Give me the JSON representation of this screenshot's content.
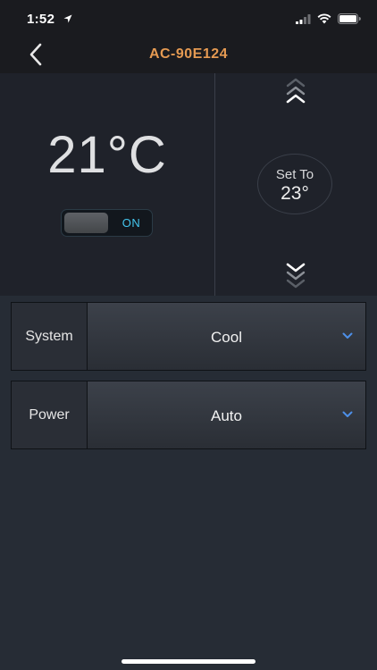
{
  "status_bar": {
    "time": "1:52",
    "icons": [
      "location-arrow-icon",
      "signal-icon",
      "wifi-icon",
      "battery-icon"
    ]
  },
  "nav": {
    "title": "AC-90E124",
    "back_icon": "chevron-left-icon"
  },
  "thermostat": {
    "current_temp": "21°C",
    "toggle": {
      "label": "ON",
      "state": "on"
    },
    "setpoint_label": "Set To",
    "setpoint_value": "23°",
    "up_icon": "chevrons-up-icon",
    "down_icon": "chevrons-down-icon"
  },
  "settings": [
    {
      "label": "System",
      "value": "Cool"
    },
    {
      "label": "Power",
      "value": "Auto"
    }
  ],
  "colors": {
    "accent_title": "#e59a52",
    "toggle_on": "#44c6ee",
    "dropdown_chevron": "#4d8fe8",
    "background": "#262c35",
    "panel": "#1f222a"
  }
}
